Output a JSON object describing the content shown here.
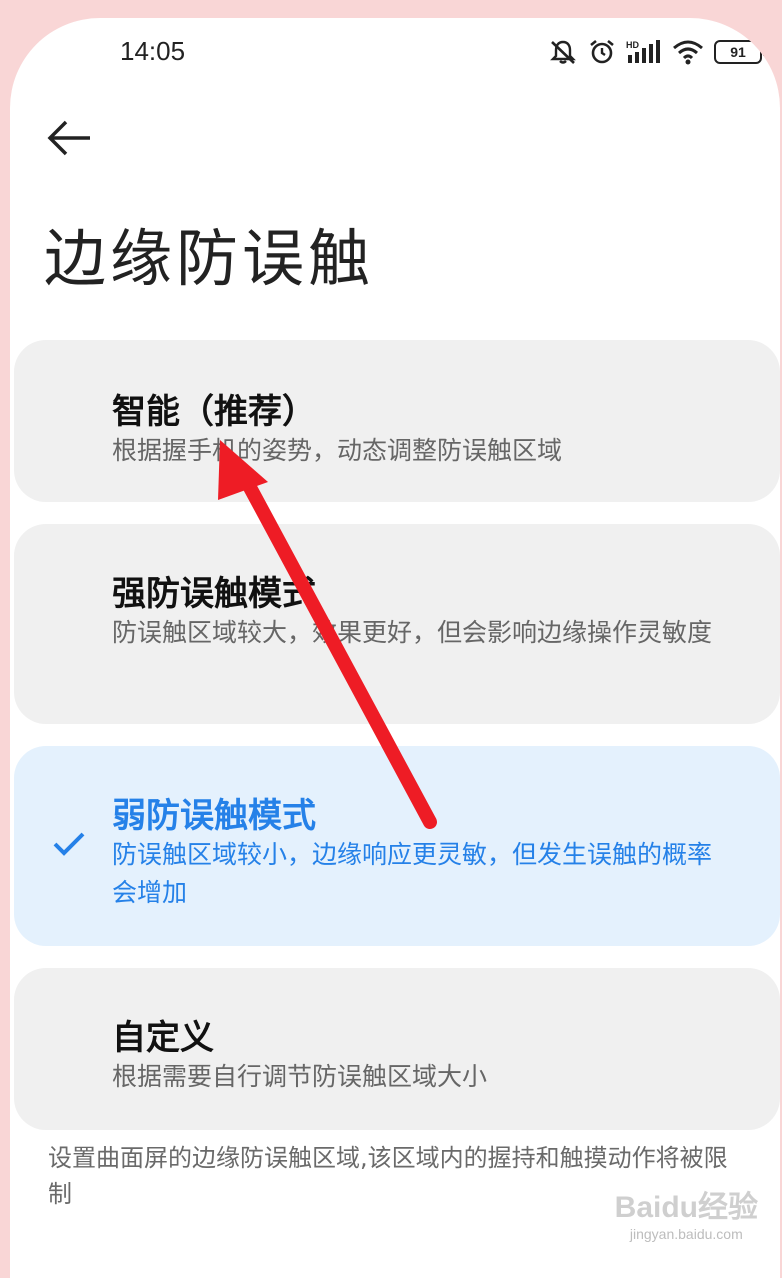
{
  "status_bar": {
    "time": "14:05",
    "signal_label": "HD",
    "battery": "91"
  },
  "header": {
    "back_icon": "back-arrow-icon",
    "title": "边缘防误触"
  },
  "options": [
    {
      "title": "智能（推荐）",
      "description": "根据握手机的姿势，动态调整防误触区域",
      "selected": false
    },
    {
      "title": "强防误触模式",
      "description": "防误触区域较大，效果更好，但会影响边缘操作灵敏度",
      "selected": false
    },
    {
      "title": "弱防误触模式",
      "description": "防误触区域较小，边缘响应更灵敏，但发生误触的概率会增加",
      "selected": true
    },
    {
      "title": "自定义",
      "description": "根据需要自行调节防误触区域大小",
      "selected": false
    }
  ],
  "footer": {
    "note": "设置曲面屏的边缘防误触区域,该区域内的握持和触摸动作将被限制"
  },
  "watermark": {
    "brand": "Baidu经验",
    "url": "jingyan.baidu.com"
  },
  "colors": {
    "accent": "#2581e8",
    "annotation_arrow": "#ee1c25",
    "card_bg": "#f0f0f0",
    "selected_bg": "#e4f1fd"
  }
}
